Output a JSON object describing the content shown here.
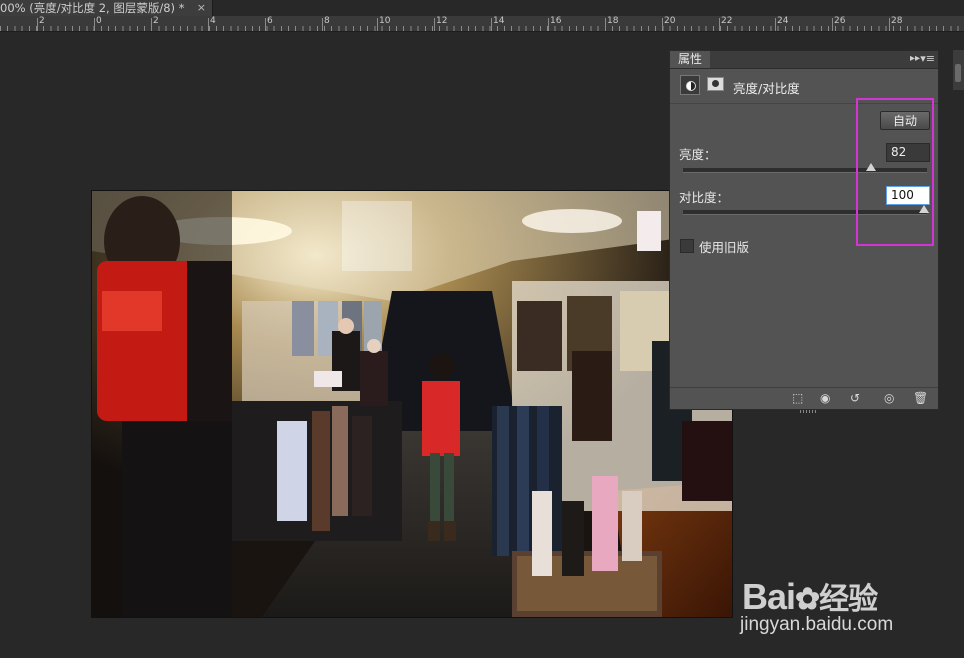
{
  "document": {
    "tab_title": "00% (亮度/对比度 2, 图层蒙版/8) *",
    "close_glyph": "×"
  },
  "ruler": {
    "labels": [
      "2",
      "0",
      "2",
      "4",
      "6",
      "8",
      "10",
      "12",
      "14",
      "16",
      "18",
      "20",
      "22",
      "24",
      "26",
      "28"
    ]
  },
  "properties_panel": {
    "tab_label": "属性",
    "collapse_glyph": "▸▸",
    "menu_glyph": "▾≡",
    "adjustment_title": "亮度/对比度",
    "auto_button": "自动",
    "brightness": {
      "label": "亮度：",
      "value": "82",
      "slider_fraction": 0.77
    },
    "contrast": {
      "label": "对比度：",
      "value": "100",
      "slider_fraction": 1.0
    },
    "legacy_checkbox": {
      "label": "使用旧版",
      "checked": false
    },
    "footer_icons": [
      "clip-to-layer-icon",
      "view-previous-state-icon",
      "reset-icon",
      "visibility-eye-icon",
      "trash-icon"
    ]
  },
  "watermark": {
    "brand": "Bai",
    "brand_suffix": "经验",
    "url": "jingyan.baidu.com"
  },
  "colors": {
    "highlight_box": "#d334d3",
    "panel_bg": "#535353",
    "workspace_bg": "#282828"
  }
}
